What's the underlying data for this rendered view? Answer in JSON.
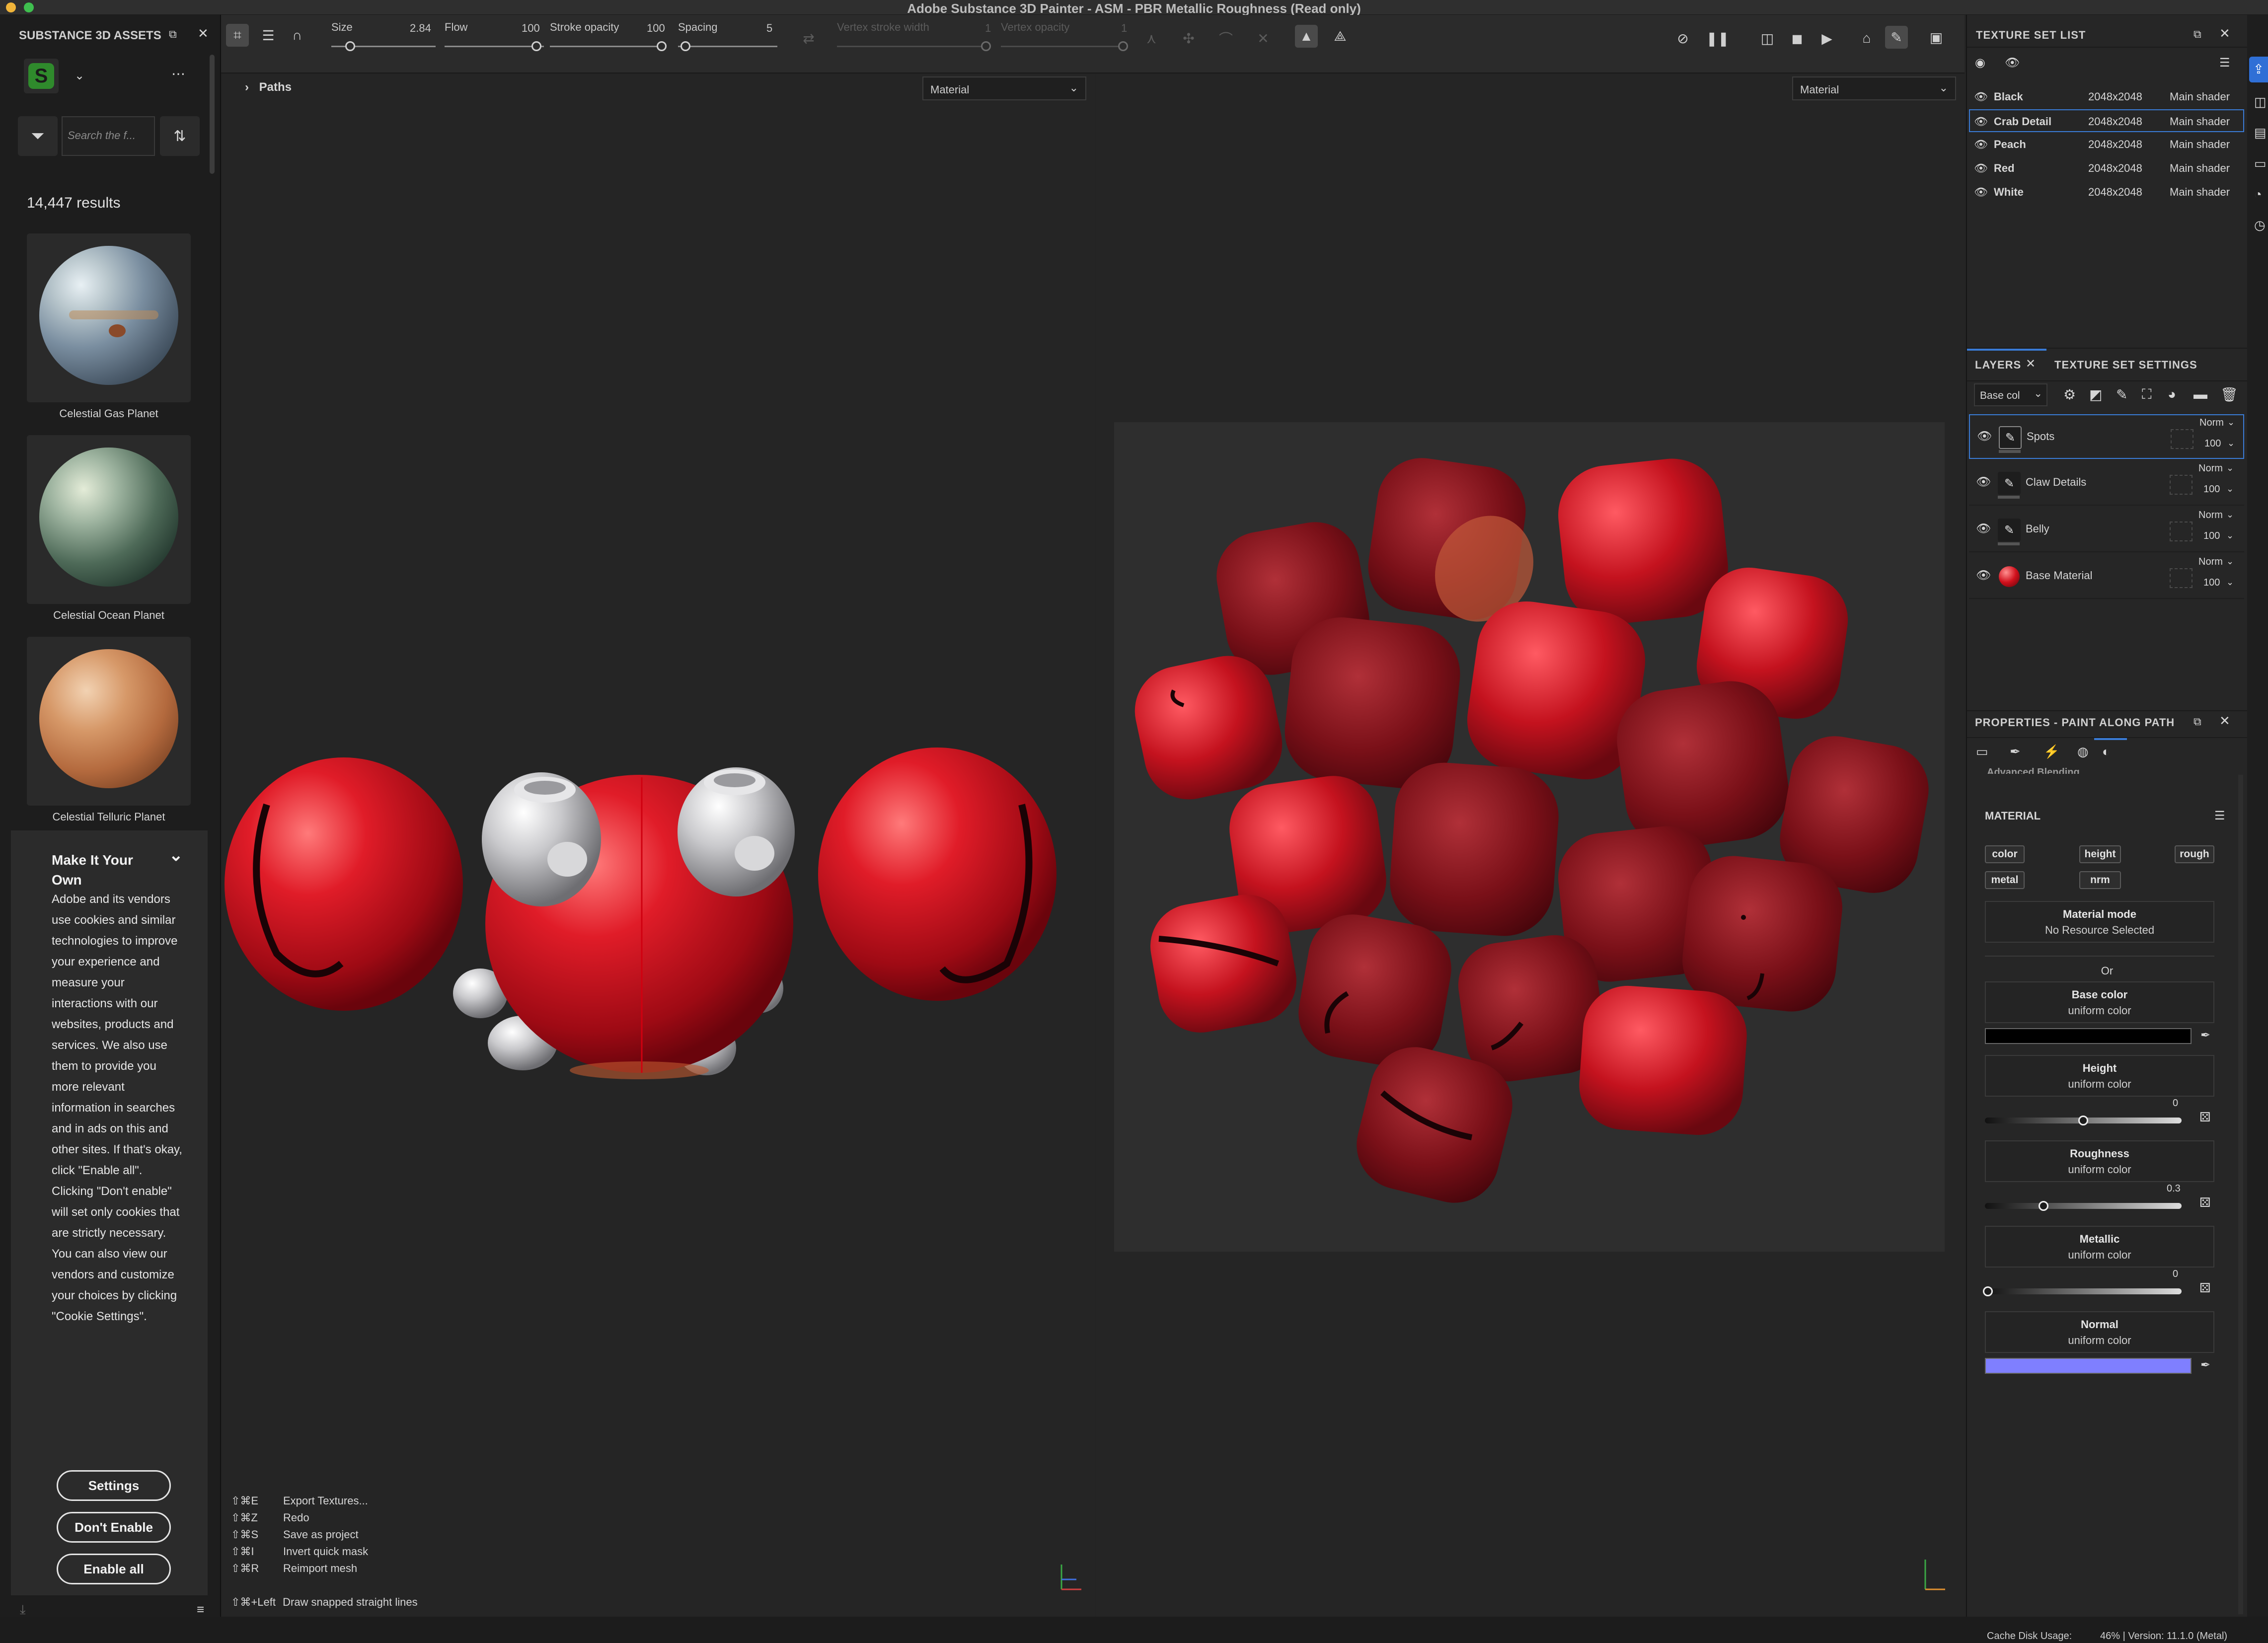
{
  "window": {
    "title": "Adobe Substance 3D Painter - ASM - PBR Metallic Roughness (Read only)"
  },
  "toolbar": {
    "size_label": "Size",
    "size_value": "2.84",
    "flow_label": "Flow",
    "flow_value": "100",
    "stroke_opacity_label": "Stroke opacity",
    "stroke_opacity_value": "100",
    "spacing_label": "Spacing",
    "spacing_value": "5",
    "vertex_stroke_width_label": "Vertex stroke width",
    "vertex_stroke_width_value": "1",
    "vertex_opacity_label": "Vertex opacity",
    "vertex_opacity_value": "1"
  },
  "assets": {
    "panel_title": "SUBSTANCE 3D ASSETS",
    "search_placeholder": "Search the f...",
    "results": "14,447 results",
    "items": [
      {
        "label": "Celestial Gas Planet"
      },
      {
        "label": "Celestial Ocean Planet"
      },
      {
        "label": "Celestial Telluric Planet"
      }
    ]
  },
  "cookie": {
    "title": "Make It Your Own",
    "body": "Adobe and its vendors use cookies and similar technologies to improve your experience and measure your interactions with our websites, products and services. We also use them to provide you more relevant information in searches and in ads on this and other sites. If that's okay, click \"Enable all\". Clicking \"Don't enable\" will set only cookies that are strictly necessary. You can also view our vendors and customize your choices by clicking \"Cookie Settings\".",
    "settings_label": "Settings",
    "dont_enable_label": "Don't Enable",
    "enable_all_label": "Enable all"
  },
  "viewport3d": {
    "breadcrumb": "Paths",
    "channel_select": "Material",
    "shortcuts": [
      {
        "key": "⇧⌘E",
        "action": "Export Textures..."
      },
      {
        "key": "⇧⌘Z",
        "action": "Redo"
      },
      {
        "key": "⇧⌘S",
        "action": "Save as project"
      },
      {
        "key": "⇧⌘I",
        "action": "Invert quick mask"
      },
      {
        "key": "⇧⌘R",
        "action": "Reimport mesh"
      }
    ],
    "hint_key": "⇧⌘+Left",
    "hint_action": "Draw snapped straight lines"
  },
  "viewport2d": {
    "channel_select": "Material"
  },
  "texture_set_list": {
    "title": "TEXTURE SET LIST",
    "rows": [
      {
        "name": "Black",
        "size": "2048x2048",
        "shader": "Main shader"
      },
      {
        "name": "Crab Detail",
        "size": "2048x2048",
        "shader": "Main shader"
      },
      {
        "name": "Peach",
        "size": "2048x2048",
        "shader": "Main shader"
      },
      {
        "name": "Red",
        "size": "2048x2048",
        "shader": "Main shader"
      },
      {
        "name": "White",
        "size": "2048x2048",
        "shader": "Main shader"
      }
    ]
  },
  "layers": {
    "tab_layers": "LAYERS",
    "tab_tss": "TEXTURE SET SETTINGS",
    "channel": "Base col",
    "rows": [
      {
        "name": "Spots",
        "blend": "Norm",
        "opacity": "100"
      },
      {
        "name": "Claw Details",
        "blend": "Norm",
        "opacity": "100"
      },
      {
        "name": "Belly",
        "blend": "Norm",
        "opacity": "100"
      },
      {
        "name": "Base Material",
        "blend": "Norm",
        "opacity": "100"
      }
    ]
  },
  "properties": {
    "title": "PROPERTIES - PAINT ALONG PATH",
    "cut_label": "Advanced Blending",
    "material_label": "MATERIAL",
    "chips": [
      "color",
      "height",
      "rough",
      "metal",
      "nrm"
    ],
    "material_mode_label": "Material mode",
    "material_mode_value": "No Resource Selected",
    "or": "Or",
    "base_color_label": "Base color",
    "base_color_value": "uniform color",
    "height_label": "Height",
    "height_value": "uniform color",
    "height_num": "0",
    "roughness_label": "Roughness",
    "roughness_value": "uniform color",
    "roughness_num": "0.3",
    "metallic_label": "Metallic",
    "metallic_value": "uniform color",
    "metallic_num": "0",
    "normal_label": "Normal",
    "normal_value": "uniform color",
    "colors": {
      "base": "#000000",
      "normal": "#7f7fff"
    }
  },
  "status": {
    "cache": "Cache Disk Usage:",
    "cache_value": "46% | Version: 11.1.0 (Metal)"
  }
}
